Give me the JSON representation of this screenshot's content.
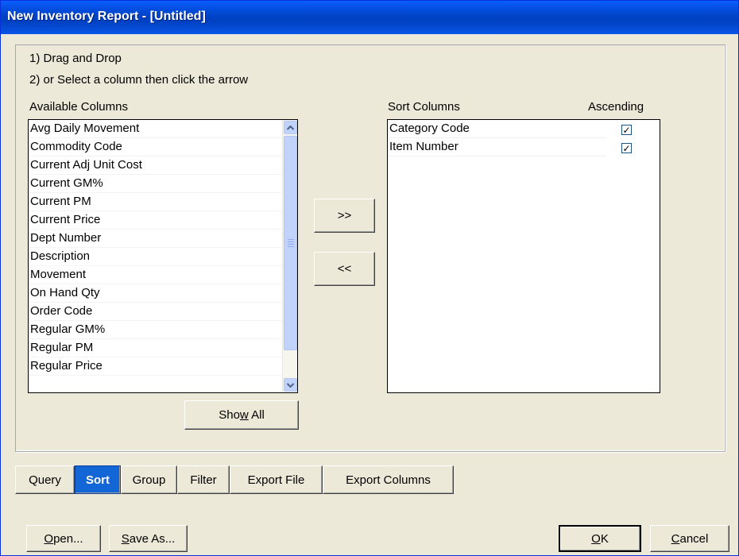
{
  "window": {
    "title": "New Inventory Report - [Untitled]"
  },
  "instructions": {
    "line1": "1) Drag and Drop",
    "line2": "2) or Select a column then click the arrow"
  },
  "available": {
    "label": "Available Columns",
    "items": [
      "Avg Daily Movement",
      "Commodity Code",
      "Current Adj Unit Cost",
      "Current GM%",
      "Current PM",
      "Current Price",
      "Dept Number",
      "Description",
      "Movement",
      "On Hand Qty",
      "Order Code",
      "Regular GM%",
      "Regular PM",
      "Regular Price"
    ],
    "show_all_pre": "Sho",
    "show_all_key": "w",
    "show_all_post": " All"
  },
  "arrows": {
    "add": ">>",
    "remove": "<<"
  },
  "sort": {
    "label": "Sort Columns",
    "ascending_label": "Ascending",
    "items": [
      {
        "name": "Category Code",
        "ascending": true
      },
      {
        "name": "Item Number",
        "ascending": true
      }
    ],
    "check_glyph": "✓"
  },
  "tabs": [
    "Query",
    "Sort",
    "Group",
    "Filter",
    "Export File",
    "Export Columns"
  ],
  "active_tab": "Sort",
  "footer": {
    "open_key": "O",
    "open_rest": "pen...",
    "saveas_key": "S",
    "saveas_rest": "ave As...",
    "ok_key": "O",
    "ok_rest": "K",
    "cancel_key": "C",
    "cancel_rest": "ancel"
  },
  "colors": {
    "title_bar": "#0a5dfc",
    "dialog_bg": "#ece9d8",
    "active_tab": "#1266d6"
  }
}
